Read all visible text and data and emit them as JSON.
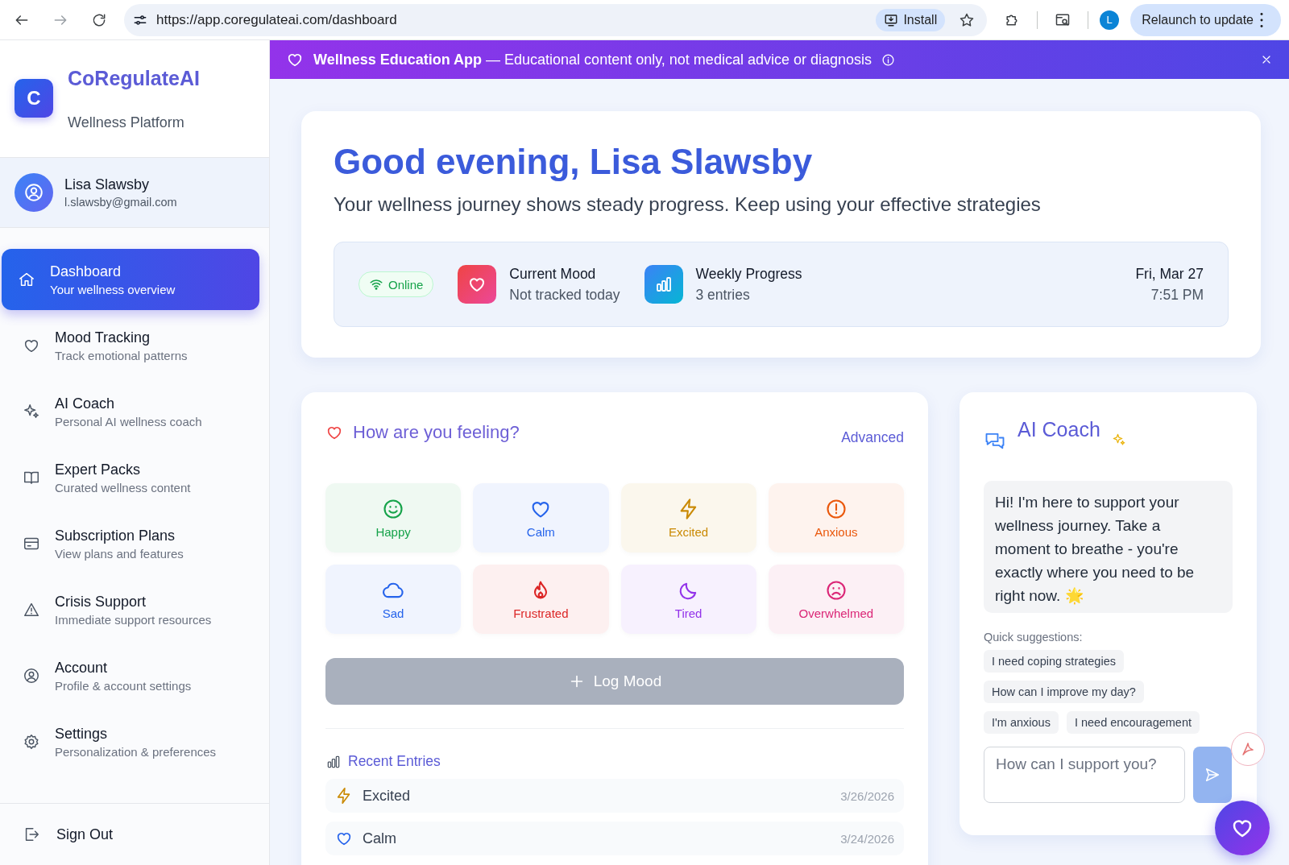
{
  "browser": {
    "url": "https://app.coregulateai.com/dashboard",
    "install_label": "Install",
    "profile_initial": "L",
    "relaunch_label": "Relaunch to update"
  },
  "banner": {
    "title": "Wellness Education App",
    "text": "— Educational content only, not medical advice or diagnosis"
  },
  "sidebar": {
    "app_initial": "C",
    "app_name": "CoRegulateAI",
    "tagline": "Wellness Platform",
    "user": {
      "name": "Lisa Slawsby",
      "email": "l.slawsby@gmail.com"
    },
    "nav": [
      {
        "kind": "home",
        "label": "Dashboard",
        "sub": "Your wellness overview",
        "selected": true
      },
      {
        "kind": "heart",
        "label": "Mood Tracking",
        "sub": "Track emotional patterns",
        "selected": false
      },
      {
        "kind": "sparkles",
        "label": "AI Coach",
        "sub": "Personal AI wellness coach",
        "selected": false
      },
      {
        "kind": "book",
        "label": "Expert Packs",
        "sub": "Curated wellness content",
        "selected": false
      },
      {
        "kind": "card",
        "label": "Subscription Plans",
        "sub": "View plans and features",
        "selected": false
      },
      {
        "kind": "warning",
        "label": "Crisis Support",
        "sub": "Immediate support resources",
        "selected": false
      },
      {
        "kind": "user",
        "label": "Account",
        "sub": "Profile & account settings",
        "selected": false
      },
      {
        "kind": "gear",
        "label": "Settings",
        "sub": "Personalization & preferences",
        "selected": false
      }
    ],
    "sign_out": "Sign Out"
  },
  "greeting": {
    "title": "Good evening, Lisa Slawsby",
    "subtitle": "Your wellness journey shows steady progress. Keep using your effective strategies",
    "status": "Online",
    "mood_label": "Current Mood",
    "mood_value": "Not tracked today",
    "progress_label": "Weekly Progress",
    "progress_value": "3 entries",
    "date": "Fri, Mar 27",
    "time": "7:51 PM"
  },
  "mood_panel": {
    "title": "How are you feeling?",
    "advanced": "Advanced",
    "moods": [
      {
        "label": "Happy",
        "kind": "smile",
        "color": "#16a34a"
      },
      {
        "label": "Calm",
        "kind": "heart",
        "color": "#2563eb"
      },
      {
        "label": "Excited",
        "kind": "zap",
        "color": "#ca8a04"
      },
      {
        "label": "Anxious",
        "kind": "alert",
        "color": "#ea580c"
      },
      {
        "label": "Sad",
        "kind": "cloud",
        "color": "#2563eb"
      },
      {
        "label": "Frustrated",
        "kind": "flame",
        "color": "#dc2626"
      },
      {
        "label": "Tired",
        "kind": "moon",
        "color": "#9333ea"
      },
      {
        "label": "Overwhelmed",
        "kind": "frown",
        "color": "#db2777"
      }
    ],
    "log_button": {
      "label": "Log Mood",
      "disabled": true
    },
    "recent_title": "Recent Entries",
    "recent": [
      {
        "label": "Excited",
        "kind": "zap",
        "color": "#ca8a04",
        "date": "3/26/2026"
      },
      {
        "label": "Calm",
        "kind": "heart",
        "color": "#2563eb",
        "date": "3/24/2026"
      }
    ]
  },
  "coach": {
    "title": "AI Coach",
    "message": "Hi! I'm here to support your wellness journey. Take a moment to breathe - you're exactly where you need to be right now. 🌟",
    "suggestions_label": "Quick suggestions:",
    "suggestions": [
      "I need coping strategies",
      "How can I improve my day?",
      "I'm anxious",
      "I need encouragement"
    ],
    "input_placeholder": "How can I support you?"
  }
}
